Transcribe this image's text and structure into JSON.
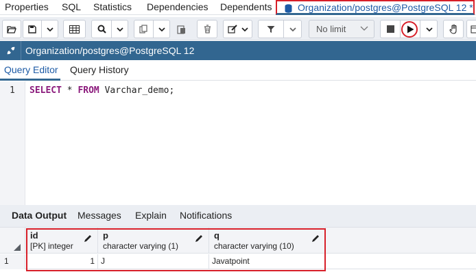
{
  "top_tabs": {
    "items": [
      "Properties",
      "SQL",
      "Statistics",
      "Dependencies",
      "Dependents"
    ],
    "active": "Organization/postgres@PostgreSQL 12 *"
  },
  "toolbar": {
    "limit_value": "No limit",
    "icons": [
      "open-folder-icon",
      "save-icon",
      "chevron-down-icon",
      "grid-icon",
      "search-icon",
      "chevron-down-icon",
      "copy-icon",
      "chevron-down-icon",
      "paste-icon",
      "trash-icon",
      "edit-icon",
      "chevron-down-icon",
      "filter-icon",
      "chevron-down-icon",
      "stop-icon",
      "play-icon",
      "chevron-down-icon",
      "hand-icon",
      "panel-icon"
    ]
  },
  "connection": {
    "label": "Organization/postgres@PostgreSQL 12"
  },
  "query_tabs": [
    "Query Editor",
    "Query History"
  ],
  "editor": {
    "line_number": "1",
    "code": {
      "kw1": "SELECT",
      "t1": " * ",
      "kw2": "FROM",
      "t2": " Varchar_demo;"
    }
  },
  "output_tabs": [
    "Data Output",
    "Messages",
    "Explain",
    "Notifications"
  ],
  "grid": {
    "columns": [
      {
        "name": "id",
        "type": "[PK] integer"
      },
      {
        "name": "p",
        "type": "character varying (1)"
      },
      {
        "name": "q",
        "type": "character varying (10)"
      }
    ],
    "rows": [
      {
        "num": "1",
        "cells": [
          "1",
          "J",
          "Javatpoint"
        ]
      }
    ]
  },
  "colors": {
    "accent": "#326690",
    "highlight": "#d71e28",
    "keyword": "#8b1a7c"
  }
}
